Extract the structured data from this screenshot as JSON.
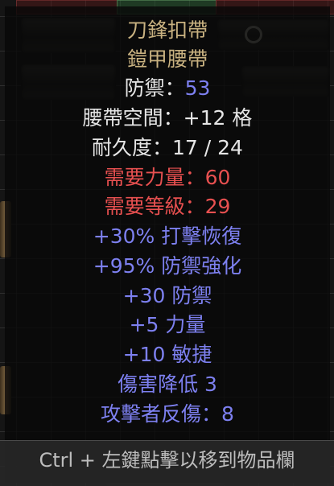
{
  "item": {
    "name": "刀鋒扣帶",
    "base_type": "鎧甲腰帶",
    "defense_label": "防禦：",
    "defense_value": "53",
    "belt_size": "腰帶空間：+12 格",
    "durability": "耐久度：17 / 24",
    "req_strength_label": "需要力量：",
    "req_strength_value": "60",
    "req_level_label": "需要等級：",
    "req_level_value": "29",
    "mods": [
      "+30% 打擊恢復",
      "+95% 防禦強化",
      "+30 防禦",
      "+5 力量",
      "+10 敏捷",
      "傷害降低 3",
      "攻擊者反傷：8"
    ]
  },
  "footer": {
    "hint": "Ctrl + 左鍵點擊以移到物品欄"
  },
  "colors": {
    "unique": "#c8b180",
    "white": "#e6e6e6",
    "magic_blue": "#7d80f0",
    "requirement_red": "#e85050"
  }
}
